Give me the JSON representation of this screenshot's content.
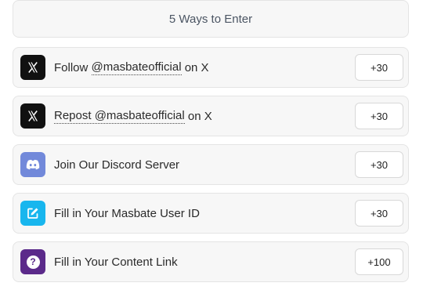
{
  "header": {
    "title": "5 Ways to Enter"
  },
  "entries": [
    {
      "pre": "Follow ",
      "handle": "@masbateofficial",
      "post": " on X",
      "points": "+30",
      "icon": "x-logo-icon",
      "color": "#111111"
    },
    {
      "pre": "Repost",
      "handle": " @masbateofficial",
      "post": " on X",
      "points": "+30",
      "icon": "x-logo-icon",
      "color": "#111111"
    },
    {
      "label": "Join Our Discord Server",
      "points": "+30",
      "icon": "discord-icon",
      "color": "#7289da"
    },
    {
      "label": "Fill in Your Masbate User ID",
      "points": "+30",
      "icon": "edit-icon",
      "color": "#18b6ee"
    },
    {
      "label": "Fill in Your Content Link",
      "points": "+100",
      "icon": "question-icon",
      "color": "#5b2a8a"
    }
  ]
}
